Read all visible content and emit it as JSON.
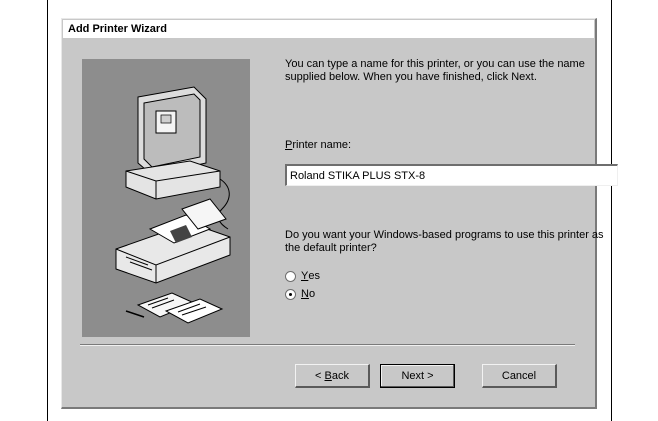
{
  "window": {
    "title": "Add Printer Wizard"
  },
  "intro_text": "You can type a name for this printer, or you can use the name supplied below. When you have finished, click Next.",
  "printer_name": {
    "label_accel": "P",
    "label_rest": "rinter name:",
    "value": "Roland STIKA PLUS STX-8"
  },
  "default_question": "Do you want your Windows-based programs to use this printer as the default printer?",
  "radios": {
    "yes": {
      "accel": "Y",
      "rest": "es",
      "checked": false
    },
    "no": {
      "accel": "N",
      "rest": "o",
      "checked": true
    }
  },
  "buttons": {
    "back_prefix": "< ",
    "back_accel": "B",
    "back_rest": "ack",
    "next": "Next >",
    "cancel": "Cancel"
  },
  "illustration": {
    "icons": [
      "computer-icon",
      "printer-icon",
      "documents-icon"
    ]
  },
  "colors": {
    "dialog_bg": "#c8c8c8",
    "illustration_bg": "#8d8d8d"
  }
}
